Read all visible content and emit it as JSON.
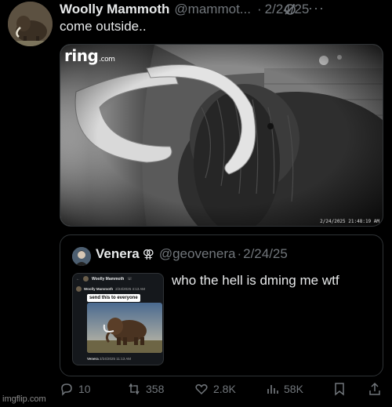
{
  "post": {
    "author_name": "Woolly Mammoth",
    "author_handle": "@mammot...",
    "separator": "·",
    "timestamp": "2/24/25",
    "more": "···",
    "text": "come outside.."
  },
  "media": {
    "ring_logo": "ring",
    "ring_logo_suffix": ".com",
    "camera_timestamp": "2/24/2025 21:48:19 AM"
  },
  "quote": {
    "author_name": "Venera",
    "gender_symbol": "⚢",
    "author_handle": "@geovenera",
    "separator": "·",
    "timestamp": "2/24/25",
    "text": "who the hell is dming me wtf",
    "thumbnail": {
      "chat_title": "Woolly Mammoth",
      "sender_name": "Woolly Mammoth",
      "sender_time": "2/24/2025 4:13 AM",
      "message": "send this to everyone",
      "reply_name": "Venera",
      "reply_time": "2/24/2025 11:13 AM"
    }
  },
  "actions": {
    "replies": "10",
    "reposts": "358",
    "likes": "2.8K",
    "views": "58K"
  },
  "watermark": "imgflip.com",
  "colors": {
    "background": "#000000",
    "text": "#e7e9ea",
    "muted": "#71767b",
    "border": "#2f3336"
  }
}
